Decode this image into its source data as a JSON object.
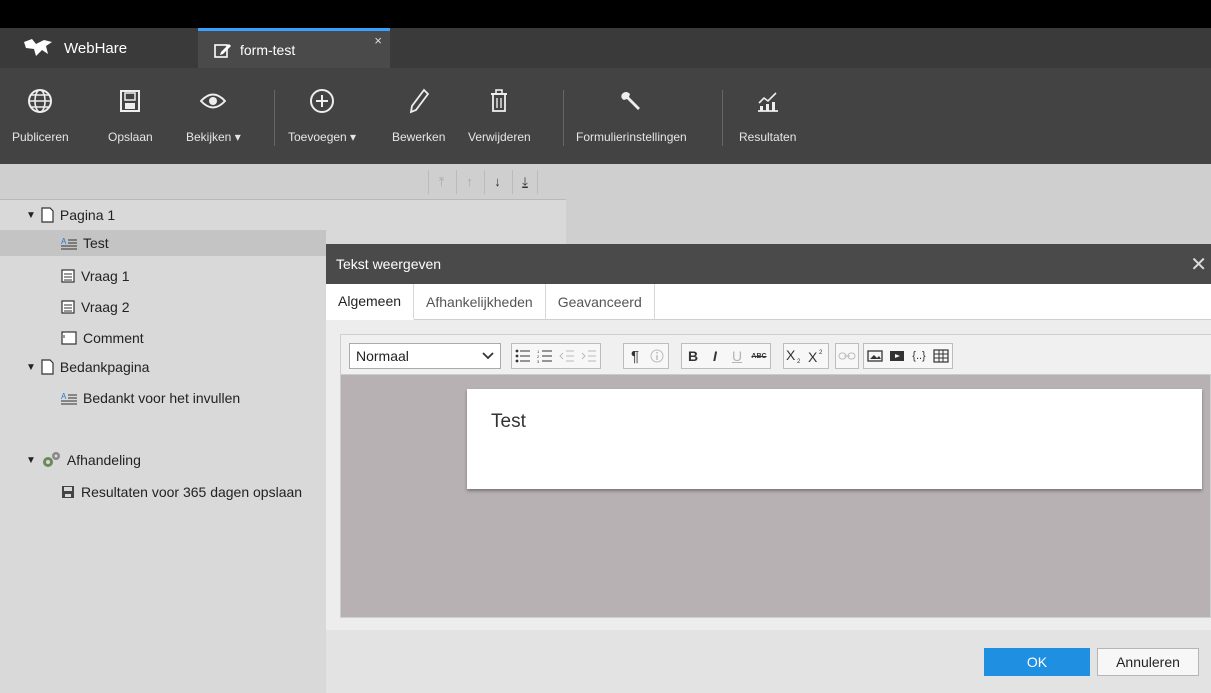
{
  "app": {
    "name": "WebHare"
  },
  "doc_tab": {
    "title": "form-test",
    "close": "×"
  },
  "toolbar": {
    "publish": "Publiceren",
    "save": "Opslaan",
    "view": "Bekijken ▾",
    "add": "Toevoegen ▾",
    "edit": "Bewerken",
    "delete": "Verwijderen",
    "form_settings": "Formulierinstellingen",
    "results": "Resultaten"
  },
  "order_buttons": {
    "top": "⤒",
    "up": "↑",
    "down": "↓",
    "bottom": "⤓"
  },
  "tree": {
    "page1": "Pagina 1",
    "test": "Test",
    "q1": "Vraag 1",
    "q2": "Vraag 2",
    "comment": "Comment",
    "thanks_page": "Bedankpagina",
    "thanks_text": "Bedankt voor het invullen",
    "handling": "Afhandeling",
    "results_store": "Resultaten voor 365 dagen opslaan"
  },
  "dialog": {
    "title": "Tekst weergeven",
    "close": "✕",
    "tabs": [
      "Algemeen",
      "Afhankelijkheden",
      "Geavanceerd"
    ],
    "style_select": "Normaal",
    "content": "Test",
    "ok": "OK",
    "cancel": "Annuleren"
  },
  "rte_icons": {
    "bold": "B",
    "italic": "I",
    "underline": "U",
    "strike": "ABC",
    "pilcrow": "¶",
    "code": "{..}"
  }
}
